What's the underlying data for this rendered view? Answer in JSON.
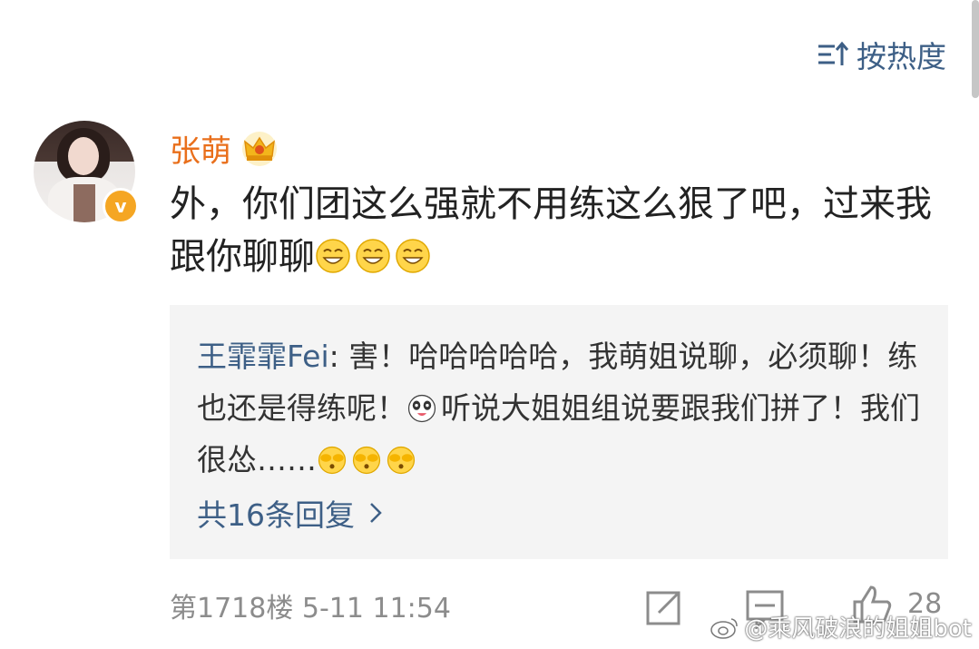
{
  "sort": {
    "label": "按热度",
    "icon": "sort-icon"
  },
  "comment": {
    "author": "张萌",
    "author_badge": "crown-icon",
    "verified_badge": "v",
    "text": "外，你们团这么强就不用练这么狠了吧，过来我跟你聊聊",
    "emojis": [
      "grin-emoji",
      "grin-emoji",
      "grin-emoji"
    ],
    "meta": "第1718楼 5-11 11:54",
    "likes": "28"
  },
  "reply": {
    "user": "王霏霏Fei",
    "separator": ": ",
    "text_part1": "害！哈哈哈哈哈，我萌姐说聊，必须聊！练也还是得练呢！",
    "text_part2": "听说大姐姐组说要跟我们拼了！我们很怂……",
    "more_label": "共16条回复"
  },
  "actions": [
    "share-icon",
    "comment-icon",
    "like-icon"
  ],
  "watermark": "@乘风破浪的姐姐bot",
  "colors": {
    "link": "#3d5f86",
    "author": "#e96f1b",
    "reply_bg": "#f4f4f4",
    "meta": "#8c8c8c"
  }
}
